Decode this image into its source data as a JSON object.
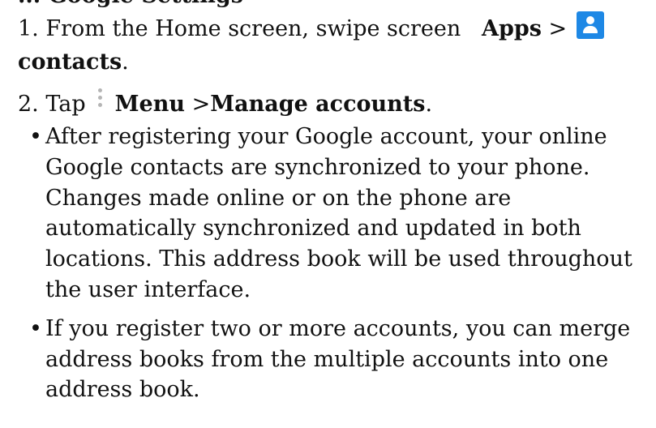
{
  "heading": {
    "partial_text": "... Google Settings"
  },
  "steps": [
    {
      "number": "1.",
      "text_before": "From the Home screen, swipe screen",
      "bold1": "Apps",
      "sep": ">",
      "icon": "contacts-person-icon",
      "bold2": "contacts",
      "end": "."
    },
    {
      "number": "2.",
      "text_before": "Tap",
      "icon": "menu-vertical-dots-icon",
      "bold1": "Menu",
      "sep": ">",
      "bold2": "Manage accounts",
      "end": "."
    }
  ],
  "bullets": [
    {
      "mark": "•",
      "text": "After registering your Google account, your online Google contacts are synchronized to your phone. Changes made online or on the phone are automatically synchronized and updated in both locations. This address book will be used throughout the user interface."
    },
    {
      "mark": "•",
      "text": "If you register two or more accounts, you can merge address books from the multiple accounts into one address book."
    }
  ],
  "colors": {
    "icon_blue": "#1e88e5",
    "menu_dots": "#b5b5b5"
  }
}
